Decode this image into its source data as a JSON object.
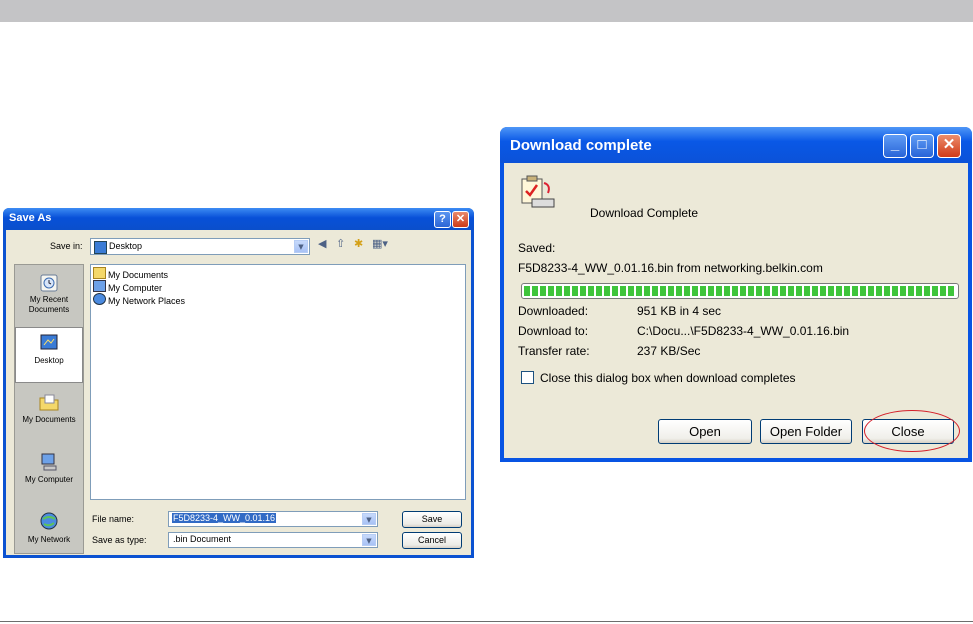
{
  "save_as": {
    "title": "Save As",
    "help_label": "?",
    "close_label": "✕",
    "save_in_label": "Save in:",
    "save_in_value": "Desktop",
    "places": [
      {
        "label": "My Recent Documents",
        "icon": "recent-documents-icon"
      },
      {
        "label": "Desktop",
        "icon": "desktop-icon"
      },
      {
        "label": "My Documents",
        "icon": "my-documents-icon"
      },
      {
        "label": "My Computer",
        "icon": "my-computer-icon"
      },
      {
        "label": "My Network",
        "icon": "my-network-icon"
      }
    ],
    "files": [
      {
        "label": "My Documents",
        "icon": "folder-icon"
      },
      {
        "label": "My Computer",
        "icon": "computer-icon"
      },
      {
        "label": "My Network Places",
        "icon": "network-icon"
      }
    ],
    "file_name_label": "File name:",
    "file_name_value": "F5D8233-4_WW_0.01.16",
    "save_type_label": "Save as type:",
    "save_type_value": ".bin Document",
    "save_button": "Save",
    "cancel_button": "Cancel"
  },
  "download": {
    "title": "Download complete",
    "min_label": "_",
    "max_label": "□",
    "close_label": "✕",
    "heading": "Download Complete",
    "saved_label": "Saved:",
    "saved_value": "F5D8233-4_WW_0.01.16.bin from networking.belkin.com",
    "progress": 1.0,
    "downloaded_label": "Downloaded:",
    "downloaded_value": "951 KB in 4 sec",
    "download_to_label": "Download to:",
    "download_to_value": "C:\\Docu...\\F5D8233-4_WW_0.01.16.bin",
    "transfer_label": "Transfer rate:",
    "transfer_value": "237 KB/Sec",
    "checkbox_label": "Close this dialog box when download completes",
    "open_button": "Open",
    "open_folder_button": "Open Folder",
    "close_button": "Close"
  },
  "colors": {
    "xp_blue": "#0854e3",
    "dialog_face": "#ece9d8",
    "progress_green": "#3fc43b",
    "highlight_red": "#d4202a"
  }
}
